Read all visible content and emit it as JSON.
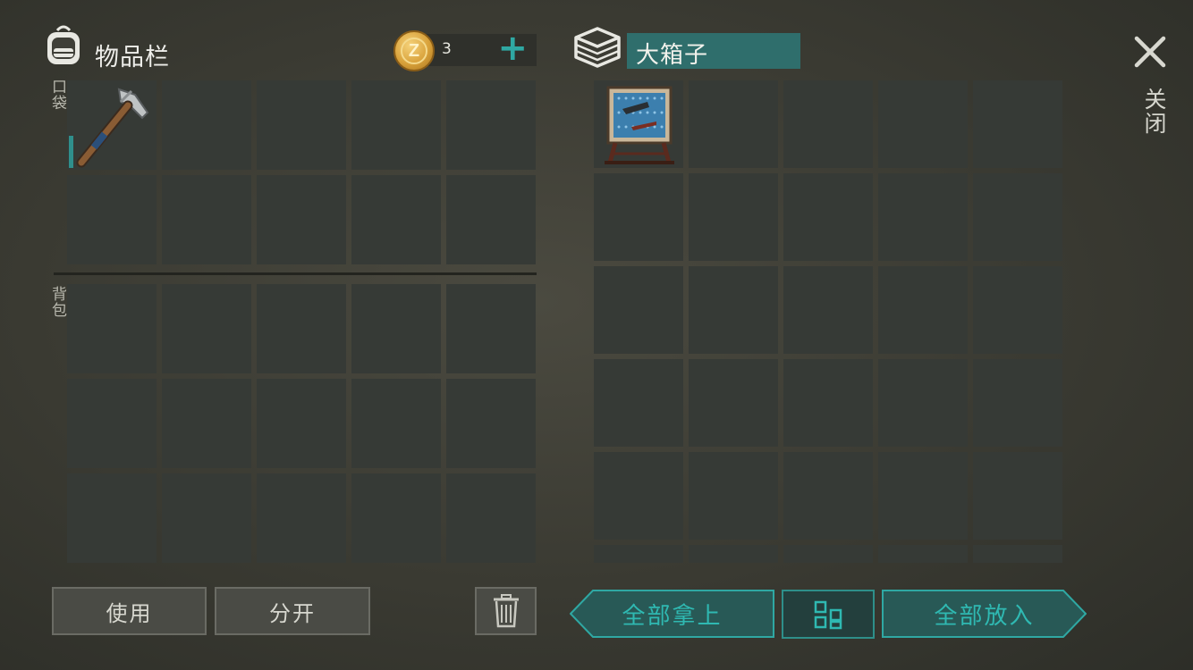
{
  "inventory": {
    "title": "物品栏",
    "coins": "3",
    "pocket_label": "口袋",
    "bag_label": "背包",
    "pocket_slots": [
      {
        "item": "pickaxe-icon",
        "durability": 0.45
      },
      {
        "item": null
      },
      {
        "item": null
      },
      {
        "item": null
      },
      {
        "item": null
      },
      {
        "item": null
      },
      {
        "item": null
      },
      {
        "item": null
      },
      {
        "item": null
      },
      {
        "item": null
      }
    ],
    "bag_slot_count": 15
  },
  "box": {
    "title": "大箱子",
    "slots": [
      {
        "item": "workbench-pegboard-icon"
      }
    ],
    "slot_count": 30
  },
  "close_label": "关闭",
  "buttons": {
    "use": "使用",
    "split": "分开",
    "take_all": "全部拿上",
    "put_all": "全部放入"
  },
  "colors": {
    "accent": "#2fa8a3",
    "slot": "#363a36",
    "box_title_bg": "#2f6e6c"
  }
}
